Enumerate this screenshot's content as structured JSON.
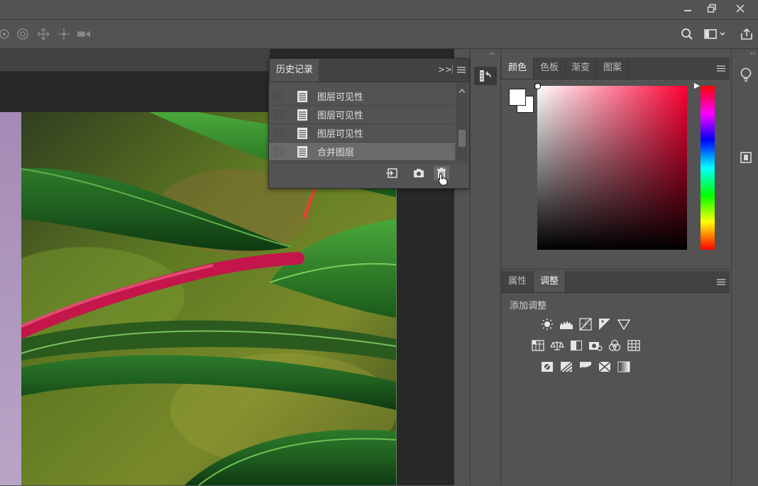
{
  "history_panel": {
    "tab_label": "历史记录",
    "expand_label": ">>",
    "items": [
      {
        "label": "图层可见性",
        "selected": false
      },
      {
        "label": "图层可见性",
        "selected": false
      },
      {
        "label": "图层可见性",
        "selected": false
      },
      {
        "label": "合并图层",
        "selected": true
      }
    ],
    "footer_icons": [
      "new-document-from-state-icon",
      "camera-icon",
      "trash-icon"
    ]
  },
  "color_panel": {
    "tabs": [
      "颜色",
      "色板",
      "渐变",
      "图案"
    ],
    "active_tab": "颜色",
    "foreground": "#ffffff",
    "background": "#ffffff",
    "hue_color": "#ff0033"
  },
  "adjustments_panel": {
    "tabs": [
      "属性",
      "调整"
    ],
    "active_tab": "调整",
    "heading": "添加调整",
    "rows": [
      [
        "brightness-contrast-icon",
        "levels-icon",
        "curves-icon",
        "exposure-icon",
        "gradient-triangle-icon"
      ],
      [
        "vibrance-icon",
        "color-balance-icon",
        "black-white-icon",
        "photo-filter-icon",
        "channel-mixer-icon",
        "color-lookup-icon"
      ],
      [
        "invert-icon",
        "posterize-icon",
        "threshold-icon",
        "selective-color-icon",
        "gradient-map-icon"
      ]
    ]
  },
  "annotations": {
    "arrow_color": "#ee3f33"
  }
}
